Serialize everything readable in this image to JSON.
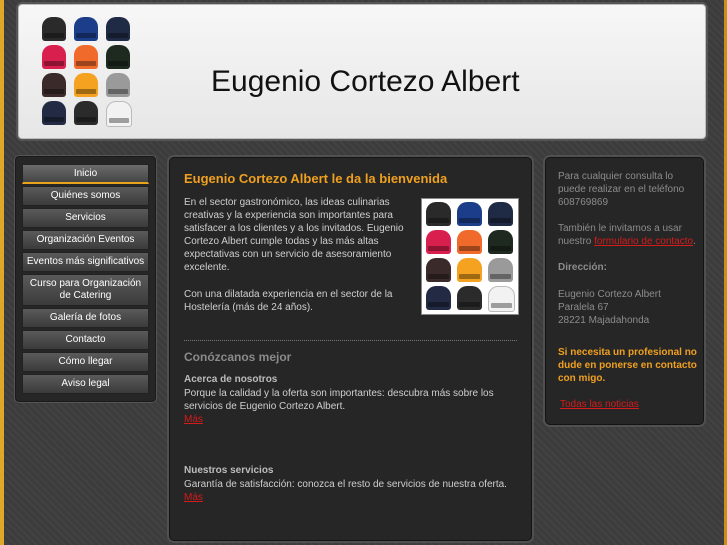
{
  "header": {
    "title": "Eugenio Cortezo Albert"
  },
  "nav": {
    "items": [
      {
        "label": "Inicio",
        "active": true
      },
      {
        "label": "Quiénes somos"
      },
      {
        "label": "Servicios"
      },
      {
        "label": "Organización Eventos"
      },
      {
        "label": "Eventos más significativos"
      },
      {
        "label": "Curso para Organización de Catering"
      },
      {
        "label": "Galería de fotos"
      },
      {
        "label": "Contacto"
      },
      {
        "label": "Cómo llegar"
      },
      {
        "label": "Aviso legal"
      }
    ]
  },
  "main": {
    "welcome_title": "Eugenio Cortezo Albert le da la bienvenida",
    "intro_p1": "En el sector gastronómico, las ideas culinarias creativas y la experiencia son importantes para satisfacer a los clientes y a los invitados. Eugenio Cortezo Albert cumple todas y las más altas expectativas con un servicio de asesoramiento excelente.",
    "intro_p2": "Con una dilatada experiencia en el sector de la Hostelería (más de 24 años).",
    "know_title": "Conózcanos mejor",
    "section1_title": "Acerca de nosotros",
    "section1_text": "Porque la calidad y la oferta son importantes: descubra más sobre los servicios de Eugenio Cortezo Albert.",
    "section1_more": "Más",
    "section2_title": "Nuestros servicios",
    "section2_text": "Garantía de satisfacción: conozca el resto de servicios de nuestra oferta.",
    "section2_more": "Más"
  },
  "side": {
    "contact_text": "Para cualquier consulta lo puede realizar en el teléfono 608769869",
    "invite_prefix": "También le invitamos a usar nuestro ",
    "invite_link": "formulario de contacto",
    "invite_suffix": ".",
    "address_label": "Dirección:",
    "address_name": "Eugenio Cortezo Albert",
    "address_street": "Paralela 67",
    "address_city": "28221 Majadahonda",
    "promo": "Si necesita un profesional no dude en ponerse en contacto con migo.",
    "news_link": "Todas las noticias"
  },
  "hat_colors": [
    "#2a2a2a",
    "#1c3e8a",
    "#1f2a44",
    "#d81f4e",
    "#f06b2b",
    "#1e2a20",
    "#3b2a2a",
    "#f4a21f",
    "#9a9a9a",
    "#222a44",
    "#2b2b2b",
    "#f2f2f2"
  ]
}
